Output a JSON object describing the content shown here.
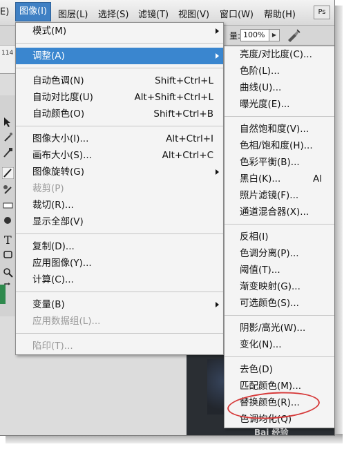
{
  "menubar": {
    "items": [
      "E)",
      "图像(I)",
      "图层(L)",
      "选择(S)",
      "滤镜(T)",
      "视图(V)",
      "窗口(W)",
      "帮助(H)"
    ],
    "logo": "Ps"
  },
  "options_bar": {
    "zoom_label": "量:",
    "zoom_value": "100%"
  },
  "ruler": {
    "value": "114"
  },
  "image_menu": {
    "items": [
      {
        "label": "模式(M)",
        "shortcut": "",
        "submenu": true,
        "enabled": true
      },
      {
        "sep": true
      },
      {
        "label": "调整(A)",
        "shortcut": "",
        "submenu": true,
        "enabled": true,
        "highlighted": true
      },
      {
        "sep": true
      },
      {
        "label": "自动色调(N)",
        "shortcut": "Shift+Ctrl+L",
        "enabled": true
      },
      {
        "label": "自动对比度(U)",
        "shortcut": "Alt+Shift+Ctrl+L",
        "enabled": true
      },
      {
        "label": "自动颜色(O)",
        "shortcut": "Shift+Ctrl+B",
        "enabled": true
      },
      {
        "sep": true
      },
      {
        "label": "图像大小(I)...",
        "shortcut": "Alt+Ctrl+I",
        "enabled": true
      },
      {
        "label": "画布大小(S)...",
        "shortcut": "Alt+Ctrl+C",
        "enabled": true
      },
      {
        "label": "图像旋转(G)",
        "shortcut": "",
        "submenu": true,
        "enabled": true
      },
      {
        "label": "裁剪(P)",
        "shortcut": "",
        "enabled": false
      },
      {
        "label": "裁切(R)...",
        "shortcut": "",
        "enabled": true
      },
      {
        "label": "显示全部(V)",
        "shortcut": "",
        "enabled": true
      },
      {
        "sep": true
      },
      {
        "label": "复制(D)...",
        "shortcut": "",
        "enabled": true
      },
      {
        "label": "应用图像(Y)...",
        "shortcut": "",
        "enabled": true
      },
      {
        "label": "计算(C)...",
        "shortcut": "",
        "enabled": true
      },
      {
        "sep": true
      },
      {
        "label": "变量(B)",
        "shortcut": "",
        "submenu": true,
        "enabled": true
      },
      {
        "label": "应用数据组(L)...",
        "shortcut": "",
        "enabled": false
      },
      {
        "sep": true
      },
      {
        "label": "陷印(T)...",
        "shortcut": "",
        "enabled": false
      }
    ]
  },
  "adjust_submenu": {
    "items": [
      {
        "label": "亮度/对比度(C)...",
        "shortcut": ""
      },
      {
        "label": "色阶(L)...",
        "shortcut": ""
      },
      {
        "label": "曲线(U)...",
        "shortcut": ""
      },
      {
        "label": "曝光度(E)...",
        "shortcut": ""
      },
      {
        "sep": true
      },
      {
        "label": "自然饱和度(V)...",
        "shortcut": ""
      },
      {
        "label": "色相/饱和度(H)...",
        "shortcut": ""
      },
      {
        "label": "色彩平衡(B)...",
        "shortcut": ""
      },
      {
        "label": "黑白(K)...",
        "shortcut": "Al"
      },
      {
        "label": "照片滤镜(F)...",
        "shortcut": ""
      },
      {
        "label": "通道混合器(X)...",
        "shortcut": ""
      },
      {
        "sep": true
      },
      {
        "label": "反相(I)",
        "shortcut": ""
      },
      {
        "label": "色调分离(P)...",
        "shortcut": ""
      },
      {
        "label": "阈值(T)...",
        "shortcut": ""
      },
      {
        "label": "渐变映射(G)...",
        "shortcut": ""
      },
      {
        "label": "可选颜色(S)...",
        "shortcut": ""
      },
      {
        "sep": true
      },
      {
        "label": "阴影/高光(W)...",
        "shortcut": ""
      },
      {
        "label": "变化(N)...",
        "shortcut": ""
      },
      {
        "sep": true
      },
      {
        "label": "去色(D)",
        "shortcut": ""
      },
      {
        "label": "匹配颜色(M)...",
        "shortcut": ""
      },
      {
        "label": "替换颜色(R)...",
        "shortcut": "",
        "circled": true
      },
      {
        "label": "色调均化(Q)",
        "shortcut": ""
      }
    ]
  },
  "watermark": "Bai 经验",
  "colors": {
    "highlight": "#3a86cf",
    "annotation": "#d63a3a"
  }
}
